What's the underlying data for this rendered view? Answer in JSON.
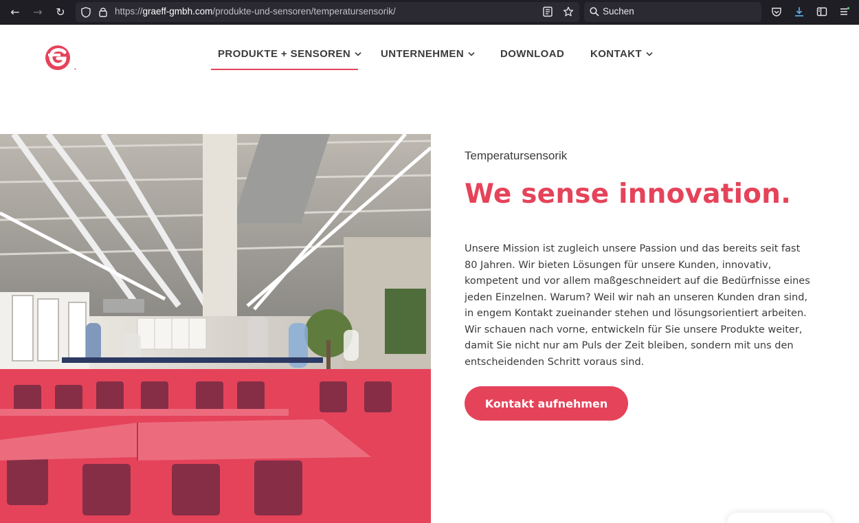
{
  "browser": {
    "url_prefix": "https://",
    "url_host": "graeff-gmbh.com",
    "url_path": "/produkte-und-sensoren/temperatursensorik/",
    "search_placeholder": "Suchen"
  },
  "nav": {
    "items": [
      {
        "label": "PRODUKTE + SENSOREN",
        "has_dropdown": true,
        "active": true
      },
      {
        "label": "UNTERNEHMEN",
        "has_dropdown": true,
        "active": false
      },
      {
        "label": "DOWNLOAD",
        "has_dropdown": false,
        "active": false
      },
      {
        "label": "KONTAKT",
        "has_dropdown": true,
        "active": false
      }
    ]
  },
  "hero": {
    "eyebrow": "Temperatursensorik",
    "headline": "We sense innovation.",
    "body": "Unsere Mission ist zugleich unsere Passion und das bereits seit fast 80 Jahren. Wir bieten Lösungen für unsere Kunden, innovativ, kompetent und vor allem maßgeschneidert auf die Bedürfnisse eines jeden Einzelnen. Warum? Weil wir nah an unseren Kunden dran sind, in engem Kontakt zueinander stehen und lösungsorientiert arbeiten. Wir schauen nach vorne, entwickeln für Sie unsere Produkte weiter, damit Sie nicht nur am Puls der Zeit bleiben, sondern mit uns den entscheidenden Schritt voraus sind.",
    "cta_label": "Kontakt aufnehmen"
  },
  "colors": {
    "brand_red": "#e5435a",
    "chrome_dark": "#1f1e25",
    "text_dark": "#3b3b3b"
  }
}
